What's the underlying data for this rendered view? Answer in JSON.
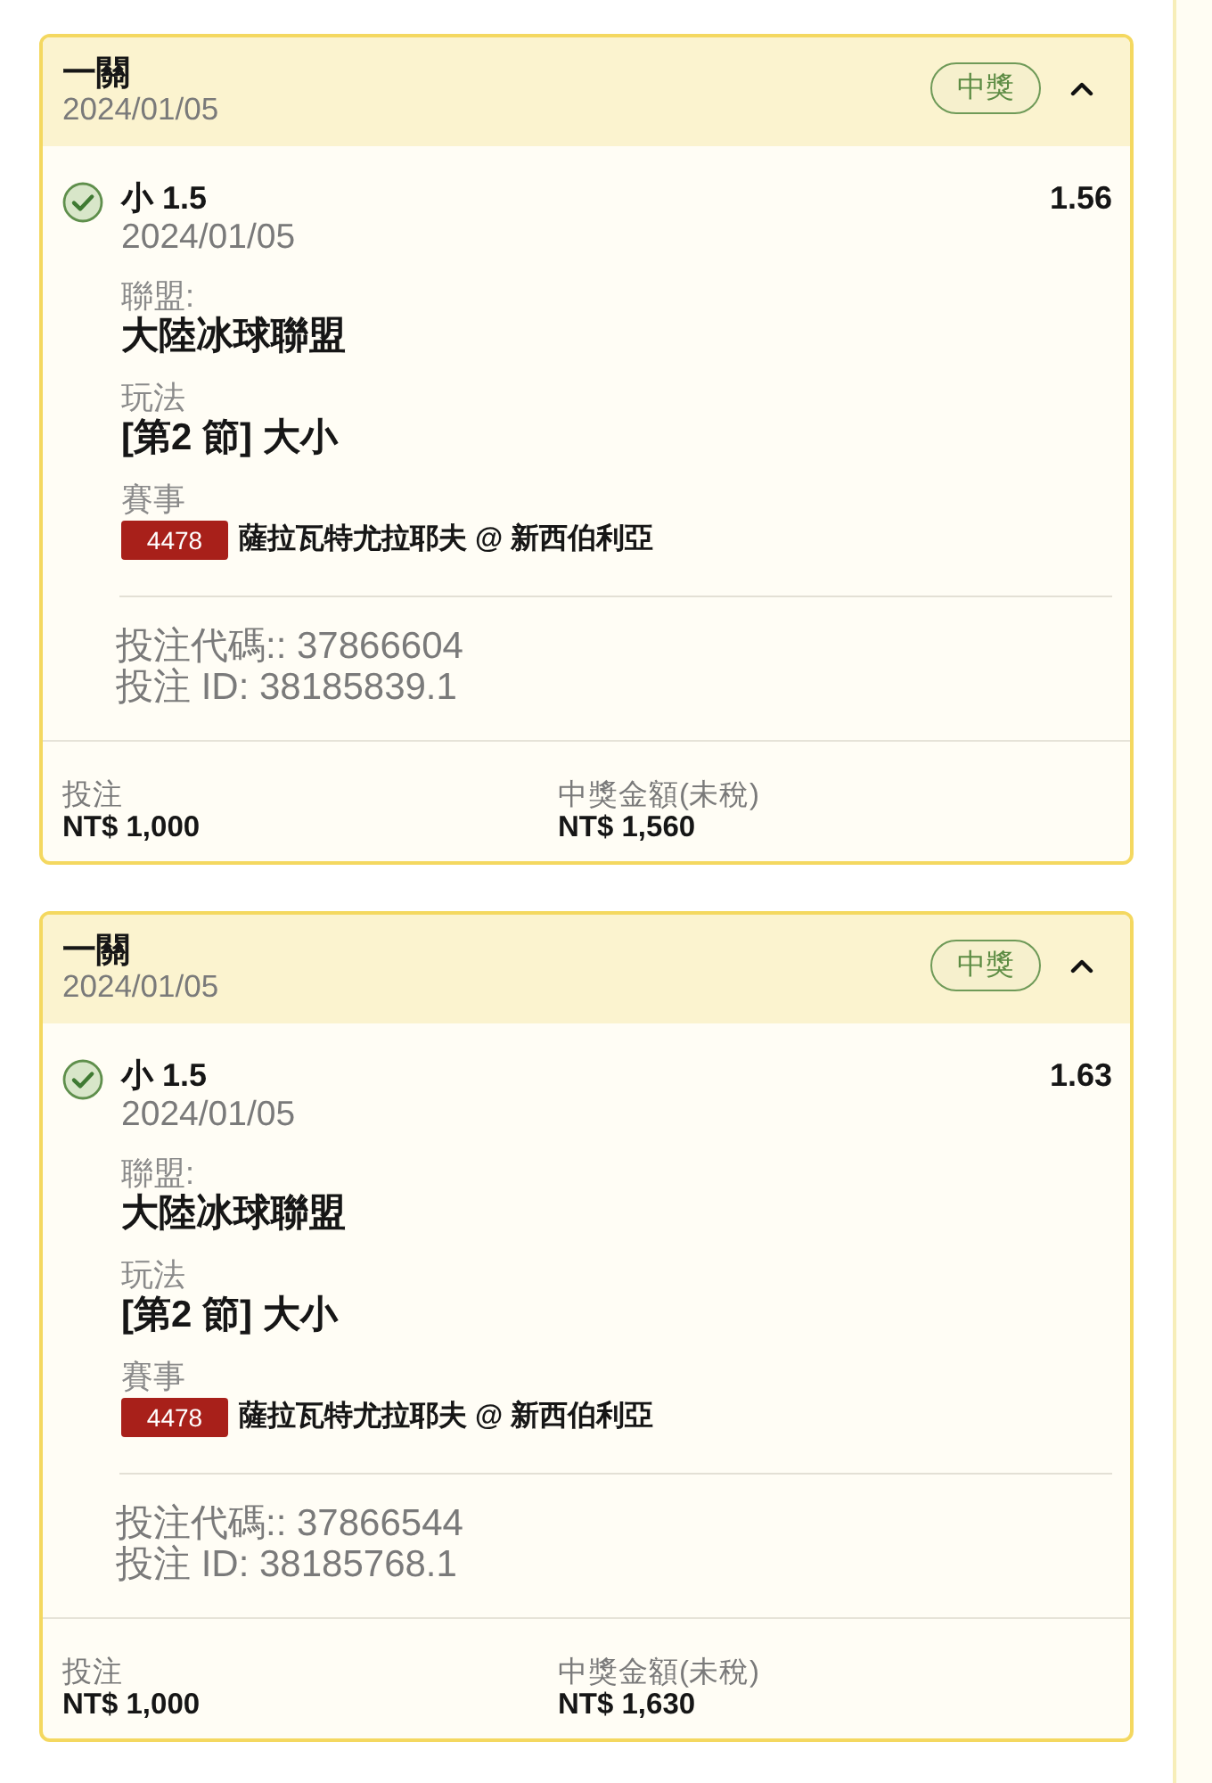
{
  "bets": [
    {
      "title": "一關",
      "date": "2024/01/05",
      "status": {
        "label": "中獎",
        "kind": "won"
      },
      "expanded": true,
      "legs": [
        {
          "won": true,
          "selection": "小 1.5",
          "odds": "1.56",
          "date": "2024/01/05",
          "details": [
            {
              "kind": "text",
              "label": "聯盟:",
              "value": "大陸冰球聯盟"
            },
            {
              "kind": "text",
              "label": "玩法",
              "value": "[第2 節] 大小"
            },
            {
              "kind": "event",
              "label": "賽事",
              "event_id": "4478",
              "value": "薩拉瓦特尤拉耶夫 @ 新西伯利亞"
            }
          ]
        }
      ],
      "codes": [
        "投注代碼:: 37866604",
        "投注 ID: 38185839.1"
      ],
      "footer": [
        {
          "label": "投注",
          "value": "NT$ 1,000"
        },
        {
          "label": "中獎金額(未稅)",
          "value": "NT$ 1,560"
        }
      ]
    },
    {
      "title": "一關",
      "date": "2024/01/05",
      "status": {
        "label": "中獎",
        "kind": "won"
      },
      "expanded": true,
      "legs": [
        {
          "won": true,
          "selection": "小 1.5",
          "odds": "1.63",
          "date": "2024/01/05",
          "details": [
            {
              "kind": "text",
              "label": "聯盟:",
              "value": "大陸冰球聯盟"
            },
            {
              "kind": "text",
              "label": "玩法",
              "value": "[第2 節] 大小"
            },
            {
              "kind": "event",
              "label": "賽事",
              "event_id": "4478",
              "value": "薩拉瓦特尤拉耶夫 @ 新西伯利亞"
            }
          ]
        }
      ],
      "codes": [
        "投注代碼:: 37866544",
        "投注 ID: 38185768.1"
      ],
      "footer": [
        {
          "label": "投注",
          "value": "NT$ 1,000"
        },
        {
          "label": "中獎金額(未稅)",
          "value": "NT$ 1,630"
        }
      ]
    }
  ]
}
